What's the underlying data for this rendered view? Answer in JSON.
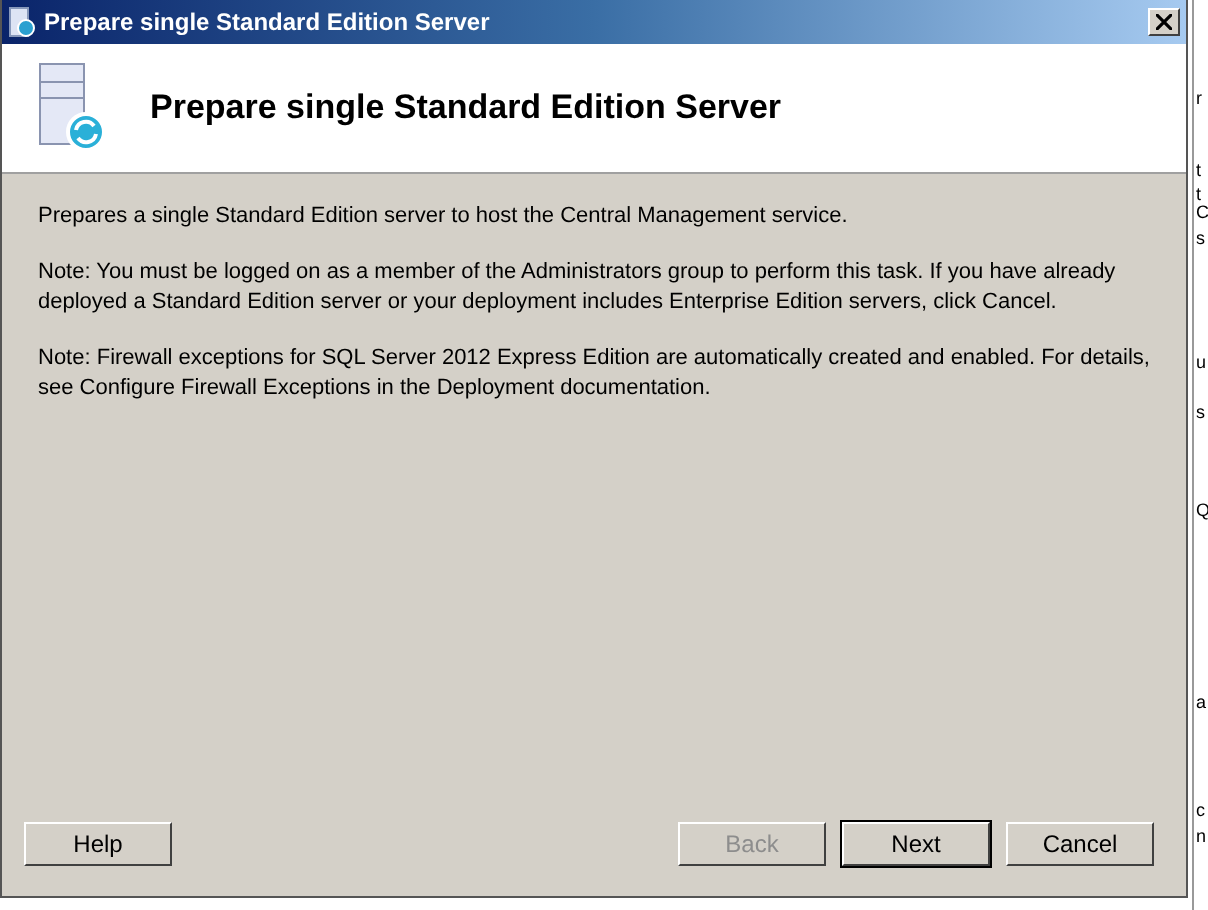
{
  "window": {
    "title": "Prepare single Standard Edition Server"
  },
  "header": {
    "title": "Prepare single Standard Edition Server"
  },
  "paragraphs": [
    "Prepares a single Standard Edition server to host the Central Management service.",
    "Note: You must be logged on as a member of the Administrators group to perform this task. If you have already deployed a Standard Edition server or your deployment includes Enterprise Edition servers, click Cancel.",
    "Note: Firewall exceptions for SQL Server 2012 Express Edition are automatically created and enabled. For details, see Configure Firewall Exceptions in the Deployment documentation."
  ],
  "buttons": [
    {
      "label": "Help",
      "disabled": false,
      "default": false
    },
    {
      "label": "Back",
      "disabled": true,
      "default": false
    },
    {
      "label": "Next",
      "disabled": false,
      "default": true
    },
    {
      "label": "Cancel",
      "disabled": false,
      "default": false
    }
  ],
  "background_window": {
    "fragments": [
      "r",
      "t",
      "t",
      "C",
      "s",
      "u",
      "s",
      "Q",
      "a",
      "c",
      "n"
    ]
  }
}
